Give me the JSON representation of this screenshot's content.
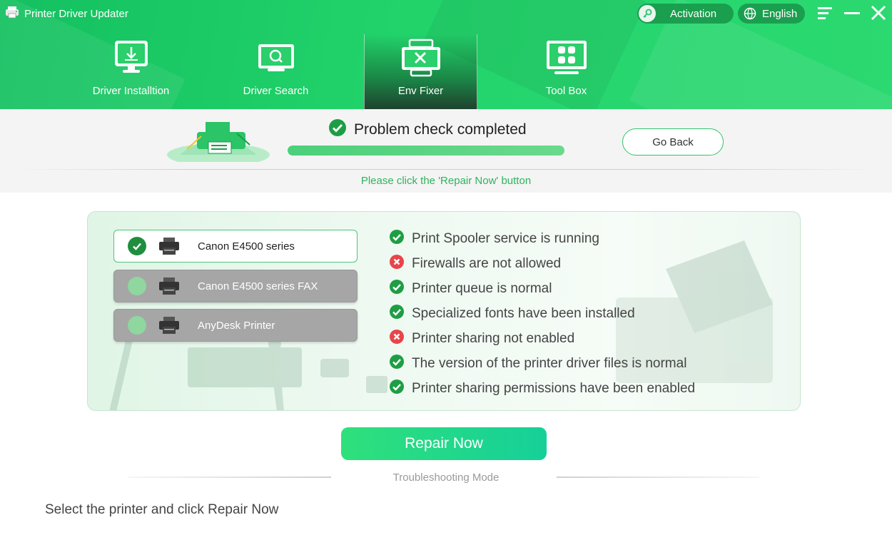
{
  "app": {
    "title": "Printer Driver Updater"
  },
  "topbar": {
    "activation_label": "Activation",
    "language_label": "English"
  },
  "tabs": [
    {
      "label": "Driver Installtion",
      "icon": "download-icon"
    },
    {
      "label": "Driver Search",
      "icon": "search-icon"
    },
    {
      "label": "Env Fixer",
      "icon": "tools-icon"
    },
    {
      "label": "Tool Box",
      "icon": "grid-icon"
    }
  ],
  "status": {
    "title": "Problem check completed",
    "progress": 1.0,
    "go_back_label": "Go Back",
    "hint": "Please click the 'Repair Now' button"
  },
  "printers": [
    {
      "name": "Canon E4500 series",
      "selected": true
    },
    {
      "name": "Canon E4500 series FAX",
      "selected": false
    },
    {
      "name": "AnyDesk Printer",
      "selected": false
    }
  ],
  "checks": [
    {
      "text": "Print Spooler service is running",
      "ok": true
    },
    {
      "text": "Firewalls are not allowed",
      "ok": false
    },
    {
      "text": "Printer queue is normal",
      "ok": true
    },
    {
      "text": "Specialized fonts have been installed",
      "ok": true
    },
    {
      "text": "Printer sharing not enabled",
      "ok": false
    },
    {
      "text": "The version of the printer driver files is normal",
      "ok": true
    },
    {
      "text": "Printer sharing permissions have been enabled",
      "ok": true
    }
  ],
  "actions": {
    "repair_label": "Repair Now",
    "troubleshooting_label": "Troubleshooting Mode"
  },
  "footer": {
    "text": "Select the printer and click Repair Now"
  },
  "colors": {
    "accent": "#22d36a",
    "ok": "#1f9d45",
    "error": "#e8454a"
  }
}
